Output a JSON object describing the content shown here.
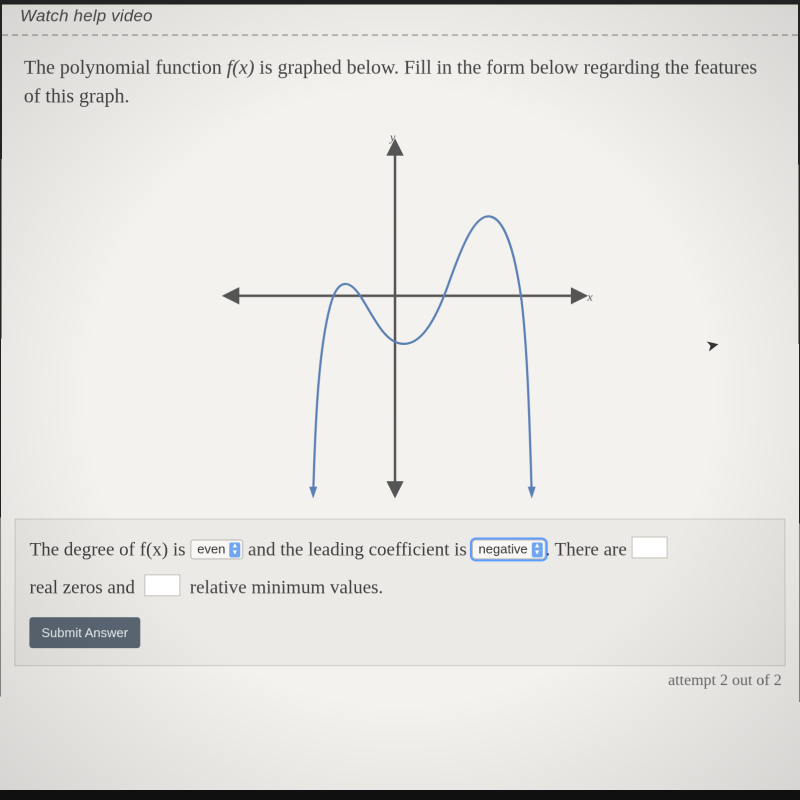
{
  "help_link": "Watch help video",
  "prompt": {
    "pre": "The polynomial function ",
    "fn": "f(x)",
    "post": " is graphed below. Fill in the form below regarding the features of this graph."
  },
  "axis_labels": {
    "x": "x",
    "y": "y"
  },
  "answer": {
    "s1": "The degree of f(x) is ",
    "degree_value": "even",
    "s2": " and the leading coefficient is",
    "coef_value": "negative",
    "s3": ". There are ",
    "s4": "real zeros and",
    "s5": "relative minimum values."
  },
  "submit_label": "Submit Answer",
  "attempt_text": "attempt 2 out of 2",
  "chart_data": {
    "type": "line",
    "title": "",
    "xlabel": "x",
    "ylabel": "y",
    "xlim": [
      -5,
      5
    ],
    "ylim": [
      -5,
      5
    ],
    "series": [
      {
        "name": "f(x)",
        "x": [
          -2.3,
          -2.0,
          -1.5,
          -1.0,
          -0.5,
          0.0,
          0.5,
          1.0,
          1.5,
          2.0,
          2.5,
          2.8,
          3.2
        ],
        "y": [
          -5.0,
          -0.5,
          0.3,
          0.0,
          -0.7,
          -1.1,
          -0.9,
          -0.2,
          1.2,
          2.0,
          1.2,
          -0.5,
          -5.0
        ]
      }
    ],
    "real_zeros": 4,
    "relative_minimums": 1
  }
}
